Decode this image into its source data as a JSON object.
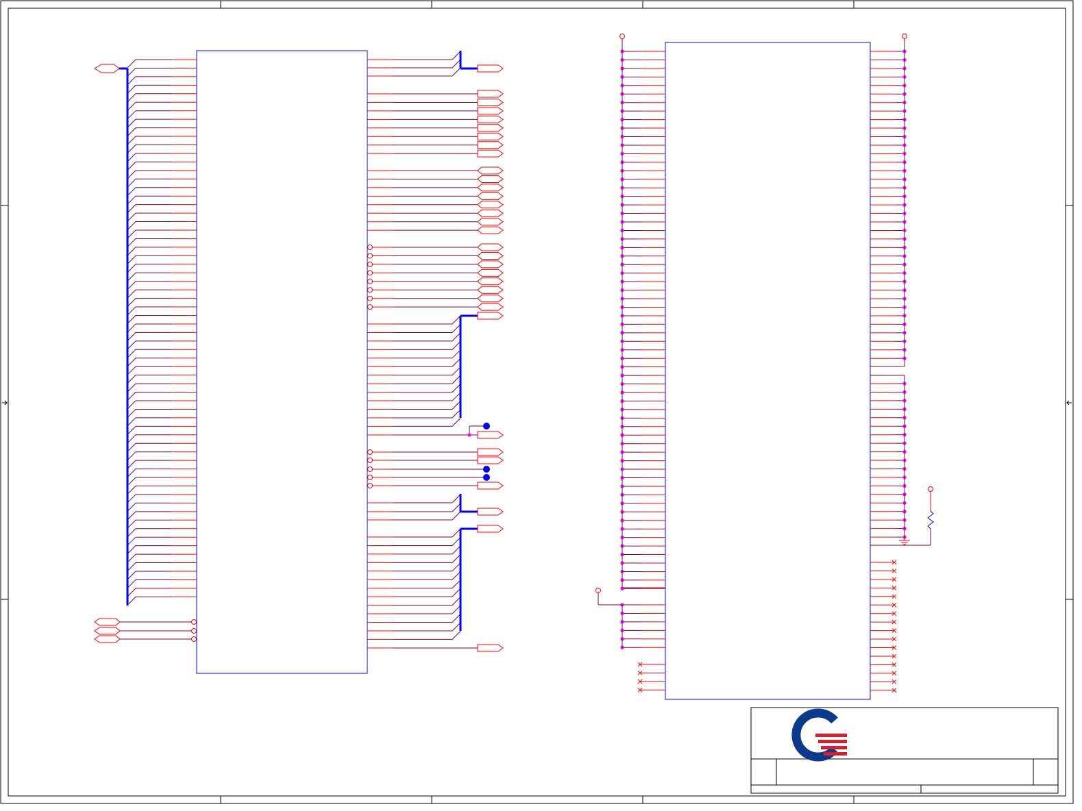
{
  "sheet": {
    "border_color": "#000000",
    "frame_markers": [
      "top",
      "bottom",
      "left",
      "right"
    ]
  },
  "colors": {
    "component_outline": "#0000ff",
    "net_wire": "#ff0000",
    "stub_wire": "#7a0040",
    "bus": "#0000ff",
    "junction": "#ff00ff",
    "no_connect": "#ff0000",
    "logo_blue": "#0b3a8c",
    "logo_red": "#d42030"
  },
  "symbols": [
    {
      "id": "u1",
      "kind": "cpu-bga",
      "left_pins": 64,
      "right_pins": 66
    },
    {
      "id": "u2",
      "kind": "power-ground-bga",
      "left_pins": 78,
      "right_pins": 78
    }
  ],
  "icons": {
    "logo": "company-logo",
    "power": "power-port-icon",
    "ground": "ground-icon",
    "resistor": "resistor-icon",
    "port": "off-page-connector-icon",
    "no_connect": "no-connect-icon"
  },
  "title_block": {
    "title": "",
    "size": "",
    "doc_number": "",
    "revision": "",
    "date": "",
    "sheet": ""
  }
}
